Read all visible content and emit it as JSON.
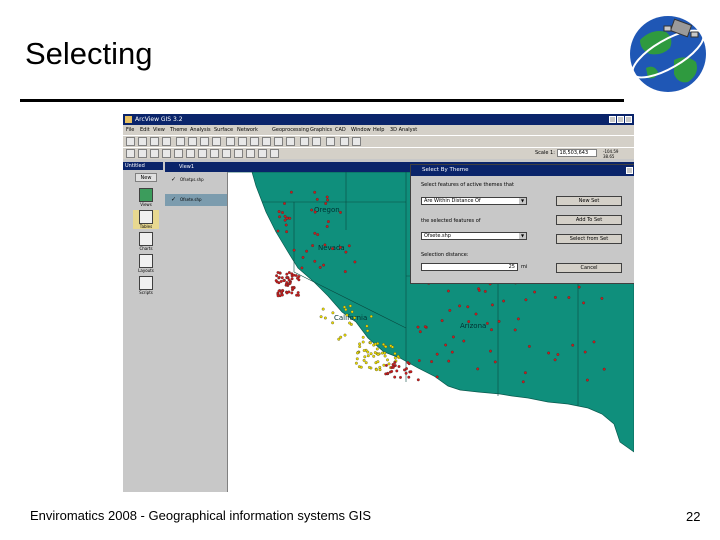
{
  "slide": {
    "title": "Selecting",
    "footer_left": "Enviromatics 2008 - Geographical information systems GIS",
    "page_number": "22"
  },
  "app": {
    "title": "ArcView GIS 3.2",
    "menu": [
      "File",
      "Edit",
      "View",
      "Theme",
      "Analysis",
      "Surface",
      "Network",
      "Geoprocessing",
      "Graphics",
      "CAD",
      "Window",
      "Help",
      "3D Analyst"
    ],
    "scale_label": "Scale 1:",
    "scale_value": "18,503,643",
    "coords": [
      "-104.59",
      "38.65"
    ]
  },
  "project": {
    "title": "Untitled",
    "new_button": "New",
    "items": [
      "Views",
      "Tables",
      "Charts",
      "Layouts",
      "Scripts"
    ]
  },
  "view": {
    "title": "View1",
    "toc": [
      "Ofsetps.shp",
      "Ofsete.shp"
    ],
    "map_labels": [
      "Oregon",
      "Nevada",
      "California",
      "Arizona"
    ]
  },
  "dialog": {
    "title": "Select By Theme",
    "prompt1": "Select features of active themes that",
    "method": "Are Within Distance Of",
    "prompt2": "the selected features of",
    "theme": "Ofsete.shp",
    "distance_label": "Selection distance:",
    "distance_value": "25",
    "distance_unit": "mi",
    "buttons": [
      "New Set",
      "Add To Set",
      "Select from Set",
      "Cancel"
    ]
  },
  "colors": {
    "land": "#0f8f7c",
    "points_red": "#cc1a1a",
    "points_yellow": "#e8d800",
    "title_bar": "#0a246a"
  }
}
